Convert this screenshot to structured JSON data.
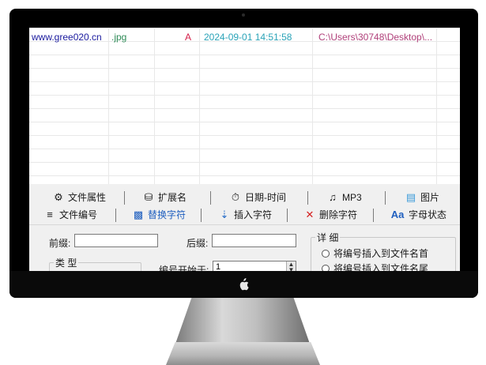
{
  "file_row": {
    "name": "www.gree020.cn",
    "extension": ".jpg",
    "attribute": "A",
    "datetime": "2024-09-01 14:51:58",
    "path": "C:\\Users\\30748\\Desktop\\..."
  },
  "tabs_row1": [
    {
      "label": "文件属性",
      "icon": "gear-icon"
    },
    {
      "label": "扩展名",
      "icon": "extension-icon"
    },
    {
      "label": "日期-时间",
      "icon": "clock-icon"
    },
    {
      "label": "MP3",
      "icon": "music-file-icon"
    },
    {
      "label": "图片",
      "icon": "image-icon"
    }
  ],
  "tabs_row2": [
    {
      "label": "文件编号",
      "icon": "numbered-list-icon"
    },
    {
      "label": "替换字符",
      "icon": "replace-icon"
    },
    {
      "label": "插入字符",
      "icon": "insert-icon"
    },
    {
      "label": "删除字符",
      "icon": "delete-icon"
    },
    {
      "label": "字母状态",
      "icon": "letter-case-icon",
      "icon_text": "Aa"
    }
  ],
  "form": {
    "prefix_label": "前缀:",
    "prefix_value": "",
    "suffix_label": "后缀:",
    "suffix_value": "",
    "type_group_title": "类 型",
    "start_label": "编号开始于:",
    "start_value": "1",
    "detail_group_title": "详 细",
    "option_1": "将编号插入到文件名首",
    "option_2": "将编号插入到文件名尾"
  },
  "colors": {
    "name_text": "#1a1a9e",
    "ext_text": "#2e8b57",
    "attr_text": "#d4204a",
    "date_text": "#2aa3b8",
    "path_text": "#b0407a",
    "active_tab": "#1f5fbf"
  }
}
